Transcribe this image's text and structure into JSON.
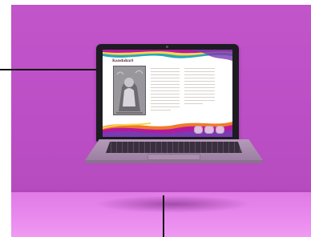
{
  "image": {
    "kind": "laptop-mockup",
    "background": "#c155c9",
    "floor_color": "#e98bee"
  },
  "screen": {
    "title": "Kandahari",
    "palette": {
      "wave_magenta": "#b5199e",
      "wave_yellow": "#f6d64a",
      "wave_teal": "#2aa6b5",
      "wave_orange": "#f07a2a",
      "wave_purple": "#7a3ab0"
    }
  }
}
